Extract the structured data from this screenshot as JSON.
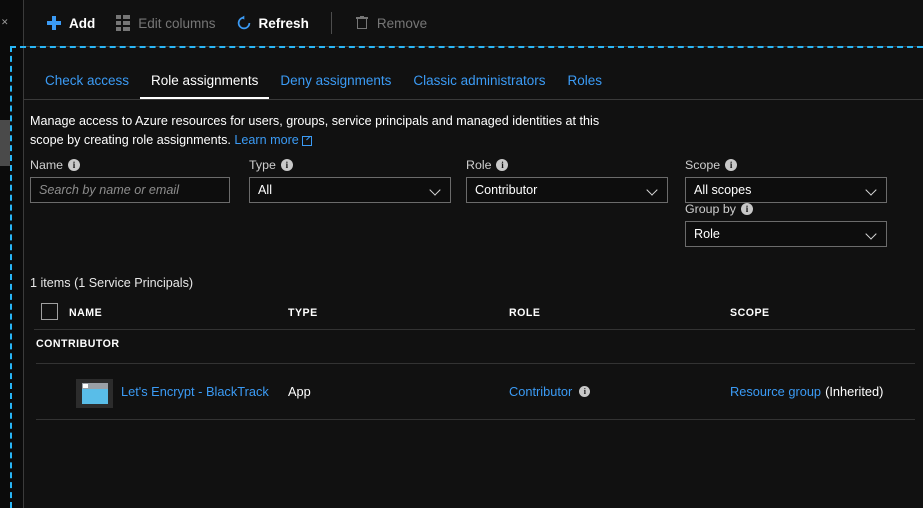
{
  "theme": {
    "background": "#111111",
    "accent_link": "#3b9bf5",
    "selection_dash": "#29b6f6",
    "disabled_text": "#767676",
    "border": "#6b6b6b"
  },
  "toolbar": {
    "items": [
      {
        "label": "Add",
        "icon": "plus-icon",
        "enabled": true
      },
      {
        "label": "Edit columns",
        "icon": "columns-icon",
        "enabled": false
      },
      {
        "label": "Refresh",
        "icon": "refresh-icon",
        "enabled": true
      },
      {
        "label": "Remove",
        "icon": "trash-icon",
        "enabled": false
      }
    ]
  },
  "tabs": [
    {
      "label": "Check access",
      "active": false
    },
    {
      "label": "Role assignments",
      "active": true
    },
    {
      "label": "Deny assignments",
      "active": false
    },
    {
      "label": "Classic administrators",
      "active": false
    },
    {
      "label": "Roles",
      "active": false
    }
  ],
  "description": {
    "text": "Manage access to Azure resources for users, groups, service principals and managed identities at this scope by creating role assignments.",
    "link_label": "Learn more",
    "link_icon": "external-link-icon"
  },
  "filters": {
    "name": {
      "label": "Name",
      "info_icon": "info-icon",
      "placeholder": "Search by name or email",
      "value": ""
    },
    "type": {
      "label": "Type",
      "info_icon": "info-icon",
      "value": "All"
    },
    "role": {
      "label": "Role",
      "info_icon": "info-icon",
      "value": "Contributor"
    },
    "scope": {
      "label": "Scope",
      "info_icon": "info-icon",
      "value": "All scopes"
    },
    "group_by": {
      "label": "Group by",
      "info_icon": "info-icon",
      "value": "Role"
    }
  },
  "results": {
    "count_text": "1 items (1 Service Principals)",
    "columns": [
      "NAME",
      "TYPE",
      "ROLE",
      "SCOPE"
    ],
    "select_all_checkbox": "select-all-checkbox",
    "groups": [
      {
        "group_label": "CONTRIBUTOR",
        "rows": [
          {
            "icon": "app-registration-icon",
            "name": "Let's Encrypt - BlackTrack",
            "type": "App",
            "role": "Contributor",
            "role_info_icon": "info-icon",
            "scope_link": "Resource group",
            "scope_suffix": "(Inherited)"
          }
        ]
      }
    ]
  }
}
